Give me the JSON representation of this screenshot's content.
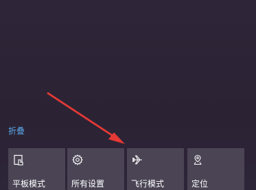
{
  "action_center": {
    "collapse_label": "折叠",
    "tiles": [
      {
        "label": "平板模式",
        "icon": "tablet-mode-icon"
      },
      {
        "label": "所有设置",
        "icon": "gear-icon"
      },
      {
        "label": "飞行模式",
        "icon": "airplane-icon"
      },
      {
        "label": "定位",
        "icon": "location-icon"
      }
    ]
  },
  "colors": {
    "background": "#2c2436",
    "tile": "#4a4454",
    "link": "#5aa7e6",
    "arrow": "#e53935"
  }
}
